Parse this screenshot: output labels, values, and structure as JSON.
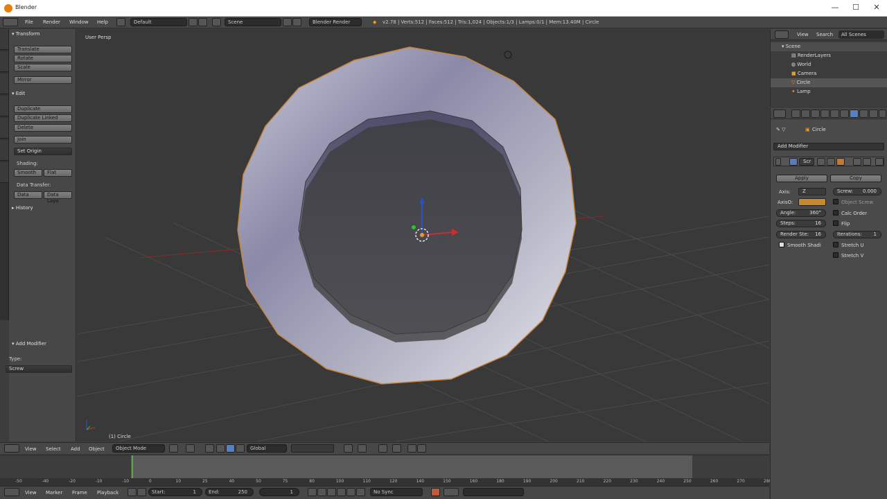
{
  "window": {
    "title": "Blender",
    "min": "—",
    "max": "☐",
    "close": "✕"
  },
  "topbar": {
    "menus": [
      "File",
      "Render",
      "Window",
      "Help"
    ],
    "layout": "Default",
    "scene": "Scene",
    "engine": "Blender Render",
    "stats": "v2.78 | Verts:512 | Faces:512 | Tris:1,024 | Objects:1/3 | Lamps:0/1 | Mem:13.40M | Circle"
  },
  "toolshelf": {
    "transform": {
      "header": "Transform",
      "buttons": [
        "Translate",
        "Rotate",
        "Scale",
        "Mirror"
      ]
    },
    "edit": {
      "header": "Edit",
      "buttons": [
        "Duplicate",
        "Duplicate Linked",
        "Delete",
        "Join"
      ],
      "set_origin": "Set Origin"
    },
    "shading": {
      "label": "Shading:",
      "smooth": "Smooth",
      "flat": "Flat"
    },
    "data_transfer": {
      "label": "Data Transfer:",
      "data": "Data",
      "data_layout": "Data Layo"
    },
    "history": "History",
    "add_modifier": {
      "header": "Add Modifier",
      "type_label": "Type:",
      "type_value": "Screw"
    }
  },
  "viewport": {
    "view_label": "User Persp",
    "object_label": "(1) Circle"
  },
  "viewport_header": {
    "menus": [
      "View",
      "Select",
      "Add",
      "Object"
    ],
    "mode": "Object Mode",
    "orientation": "Global"
  },
  "timeline": {
    "ticks": [
      "-50",
      "-40",
      "-20",
      "-10",
      "-10",
      "0",
      "10",
      "25",
      "40",
      "50",
      "75",
      "80",
      "100",
      "110",
      "120",
      "140",
      "150",
      "160",
      "180",
      "190",
      "200",
      "210",
      "220",
      "230",
      "240",
      "250",
      "260",
      "270",
      "280"
    ]
  },
  "timeline_header": {
    "menus": [
      "View",
      "Marker",
      "Frame",
      "Playback"
    ],
    "start": "Start:",
    "start_value": "1",
    "end": "End:",
    "end_value": "250",
    "current": "1",
    "sync": "No Sync"
  },
  "outliner": {
    "menus": [
      "View",
      "Search",
      "All Scenes"
    ],
    "items": [
      "Scene",
      "RenderLayers",
      "World",
      "Camera",
      "Circle",
      "Lamp"
    ]
  },
  "properties": {
    "object_name": "Circle",
    "add_modifier": "Add Modifier",
    "modifier_name": "Scr",
    "apply": "Apply",
    "copy": "Copy",
    "axis_label": "Axis:",
    "axis_value": "Z",
    "axis_ob_label": "AxisO:",
    "screw_label": "Screw:",
    "screw_value": "0.000",
    "object_screw": "Object Screw",
    "angle_label": "Angle:",
    "angle_value": "360°",
    "calc_order": "Calc Order",
    "steps_label": "Steps:",
    "steps_value": "16",
    "flip": "Flip",
    "render_steps_label": "Render Ste:",
    "render_steps_value": "16",
    "iterations_label": "Iterations:",
    "iterations_value": "1",
    "smooth_shading": "Smooth Shadi",
    "stretch_u": "Stretch U",
    "stretch_v": "Stretch V"
  }
}
